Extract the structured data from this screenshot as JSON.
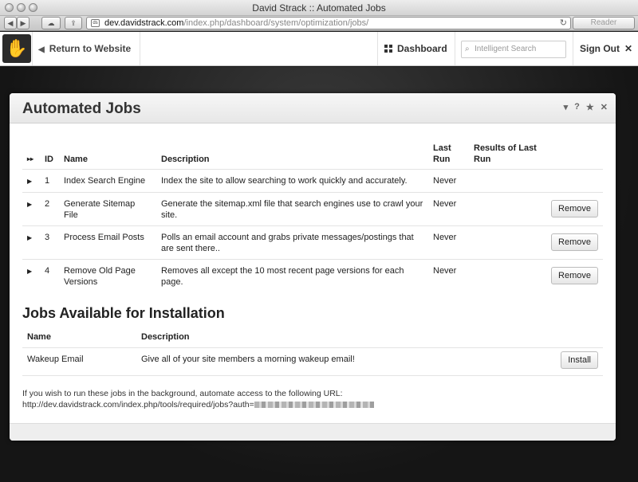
{
  "window": {
    "title": "David Strack :: Automated Jobs"
  },
  "browser": {
    "url_host": "dev.davidstrack.com",
    "url_path": "/index.php/dashboard/system/optimization/jobs/",
    "reader_label": "Reader"
  },
  "topbar": {
    "return_label": "Return to Website",
    "dashboard_label": "Dashboard",
    "search_placeholder": "Intelligent Search",
    "signout_label": "Sign Out"
  },
  "panel": {
    "title": "Automated Jobs",
    "icons": [
      "chevron-down-icon",
      "help-icon",
      "star-icon",
      "close-icon"
    ]
  },
  "jobs_table": {
    "headers": {
      "id": "ID",
      "name": "Name",
      "description": "Description",
      "last_run": "Last Run",
      "results": "Results of Last Run"
    },
    "rows": [
      {
        "id": "1",
        "name": "Index Search Engine",
        "description": "Index the site to allow searching to work quickly and accurately.",
        "last_run": "Never",
        "action": ""
      },
      {
        "id": "2",
        "name": "Generate Sitemap File",
        "description": "Generate the sitemap.xml file that search engines use to crawl your site.",
        "last_run": "Never",
        "action": "Remove"
      },
      {
        "id": "3",
        "name": "Process Email Posts",
        "description": "Polls an email account and grabs private messages/postings that are sent there..",
        "last_run": "Never",
        "action": "Remove"
      },
      {
        "id": "4",
        "name": "Remove Old Page Versions",
        "description": "Removes all except the 10 most recent page versions for each page.",
        "last_run": "Never",
        "action": "Remove"
      }
    ]
  },
  "available": {
    "title": "Jobs Available for Installation",
    "headers": {
      "name": "Name",
      "description": "Description"
    },
    "rows": [
      {
        "name": "Wakeup Email",
        "description": "Give all of your site members a morning wakeup email!",
        "action": "Install"
      }
    ]
  },
  "note": {
    "text": "If you wish to run these jobs in the background, automate access to the following URL:",
    "url_prefix": "http://dev.davidstrack.com/index.php/tools/required/jobs?auth="
  }
}
